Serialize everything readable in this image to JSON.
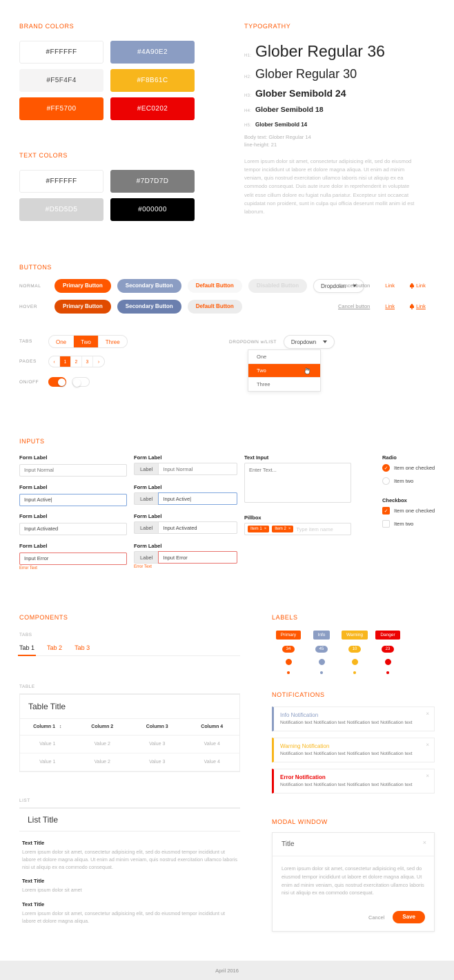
{
  "brand_colors": {
    "title": "BRAND COLORS",
    "swatches": [
      {
        "hex": "#FFFFFF",
        "label": "#FFFFFF",
        "text": "#333333",
        "border": true
      },
      {
        "hex": "#4A90E2",
        "label": "#4A90E2",
        "text": "#ffffff",
        "border": false,
        "render": "#8b9dc3"
      },
      {
        "hex": "#F5F4F4",
        "label": "#F5F4F4",
        "text": "#333333",
        "border": false
      },
      {
        "hex": "#F8B61C",
        "label": "#F8B61C",
        "text": "#ffffff",
        "border": false
      },
      {
        "hex": "#FF5700",
        "label": "#FF5700",
        "text": "#ffffff",
        "border": false
      },
      {
        "hex": "#EC0202",
        "label": "#EC0202",
        "text": "#ffffff",
        "border": false
      }
    ]
  },
  "text_colors": {
    "title": "TEXT COLORS",
    "swatches": [
      {
        "hex": "#FFFFFF",
        "label": "#FFFFFF",
        "text": "#333333",
        "border": true
      },
      {
        "hex": "#7D7D7D",
        "label": "#7D7D7D",
        "text": "#ffffff",
        "border": false
      },
      {
        "hex": "#D5D5D5",
        "label": "#D5D5D5",
        "text": "#ffffff",
        "border": false
      },
      {
        "hex": "#000000",
        "label": "#000000",
        "text": "#ffffff",
        "border": false
      }
    ]
  },
  "typography": {
    "title": "TYPOGRATHY",
    "rows": [
      {
        "tag": "H1:",
        "sample": "Glober Regular 36"
      },
      {
        "tag": "H2:",
        "sample": "Glober Regular 30"
      },
      {
        "tag": "H3:",
        "sample": "Glober Semibold 24"
      },
      {
        "tag": "H4:",
        "sample": "Glober Semibold 18"
      },
      {
        "tag": "H5:",
        "sample": "Glober Semibold 14"
      }
    ],
    "body_note_1": "Body text: Glober Regular 14",
    "body_note_2": "line-height: 21",
    "body_paragraph": "Lorem ipsum dolor sit amet, consectetur adipisicing elit, sed do eiusmod tempor incididunt ut labore et dolore magna aliqua. Ut enim ad minim veniam, quis nostrud exercitation ullamco laboris nisi ut aliquip ex ea commodo consequat. Duis aute irure dolor in reprehenderit in voluptate velit esse cillum dolore eu fugiat nulla pariatur. Excepteur sint occaecat cupidatat non proident, sunt in culpa qui officia deserunt mollit anim id est laborum."
  },
  "buttons": {
    "title": "BUTTONS",
    "normal_label": "NORMAL",
    "hover_label": "HOVER",
    "primary": "Primary Button",
    "secondary": "Secondary Button",
    "default": "Default Button",
    "disabled": "Disabled Button",
    "dropdown": "Dropdown",
    "cancel": "Cancel button",
    "link": "Link",
    "icon_link": "Link",
    "tabs_label": "TABS",
    "pages_label": "PAGES",
    "onoff_label": "ON/OFF",
    "tabs": [
      "One",
      "Two",
      "Three"
    ],
    "tabs_active": "Two",
    "pager": [
      "1",
      "2",
      "3"
    ],
    "pager_active": "1",
    "pager_prev": "‹",
    "pager_next": "›",
    "dropdown_list_label": "DROPDOWN w/LIST",
    "dropdown_options": [
      "One",
      "Two",
      "Three"
    ],
    "dropdown_selected": "Two"
  },
  "inputs": {
    "title": "INPUTS",
    "form_label": "Form Label",
    "addon_label": "Label",
    "placeholder_normal": "Input Normal",
    "value_active": "Input Active|",
    "value_activated": "Input Activated",
    "value_error": "Input Error",
    "error_text": "Error Text",
    "text_input_label": "Text Input",
    "text_input_placeholder": "Enter Text...",
    "pillbox_label": "Pillbox",
    "pillbox_chips": [
      "Item 1",
      "Item 2"
    ],
    "pillbox_placeholder": "Type item name",
    "radio_label": "Radio",
    "checkbox_label": "Checkbox",
    "option_one": "Item one checked",
    "option_two": "Item two"
  },
  "components": {
    "title": "COMPONENTS",
    "tabs_label": "TABS",
    "tabs": [
      "Tab 1",
      "Tab 2",
      "Tab 3"
    ],
    "tabs_active": "Tab 1",
    "table_label": "TABLE",
    "table_title": "Table Title",
    "table_columns": [
      "Column 1",
      "Column 2",
      "Column 3",
      "Column 4"
    ],
    "table_sort_icon": "↕",
    "table_rows": [
      [
        "Value 1",
        "Value 2",
        "Value 3",
        "Value 4"
      ],
      [
        "Value 1",
        "Value 2",
        "Value 3",
        "Value 4"
      ]
    ],
    "list_label": "LIST",
    "list_title": "List Title",
    "list_items": [
      {
        "title": "Text Title",
        "body": "Lorem ipsum dolor sit amet, consectetur adipisicing elit, sed do eiusmod tempor incididunt ut labore et dolore magna aliqua. Ut enim ad minim veniam, quis nostrud exercitation ullamco laboris nisi ut aliquip ex ea commodo consequat."
      },
      {
        "title": "Text Title",
        "body": "Lorem ipsum dolor sit amet"
      },
      {
        "title": "Text Title",
        "body": "Lorem ipsum dolor sit amet, consectetur adipisicing elit, sed do eiusmod tempor incididunt ut labore et dolore magna aliqua."
      }
    ]
  },
  "labels": {
    "title": "LABELS",
    "items": [
      {
        "name": "Primary",
        "color": "#FF5700",
        "count": "34"
      },
      {
        "name": "Info",
        "color": "#8b9dc3",
        "count": "45"
      },
      {
        "name": "Warning",
        "color": "#F8B61C",
        "count": "10"
      },
      {
        "name": "Danger",
        "color": "#EC0202",
        "count": "23"
      }
    ]
  },
  "notifications": {
    "title": "NOTIFICATIONS",
    "close_icon": "×",
    "items": [
      {
        "title": "Info Notification",
        "color": "#8b9dc3",
        "body": "Notification text Notification text Notification text Notification text"
      },
      {
        "title": "Warning Notification",
        "color": "#F8B61C",
        "body": "Notification text Notification text Notification text Notification text"
      },
      {
        "title": "Error Notification",
        "color": "#EC0202",
        "body": "Notification text Notification text Notification text Notification text"
      }
    ]
  },
  "modal": {
    "section_title": "MODAL WINDOW",
    "title": "Title",
    "close_icon": "×",
    "body": "Lorem ipsum dolor sit amet, consectetur adipisicing elit, sed do eiusmod tempor incididunt ut labore et dolore magna aliqua. Ut enim ad minim veniam, quis nostrud exercitation ullamco laboris nisi ut aliquip ex ea commodo consequat.",
    "cancel": "Cancel",
    "save": "Save"
  },
  "footer": {
    "text": "April 2016"
  }
}
